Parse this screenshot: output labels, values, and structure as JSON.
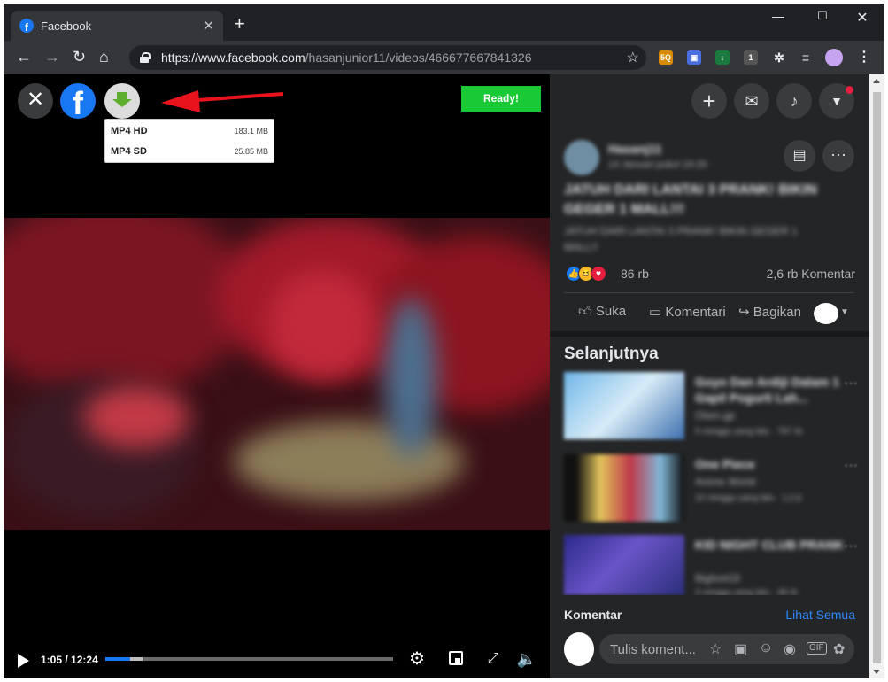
{
  "browser": {
    "tab_title": "Facebook",
    "url_host": "https://www.facebook.com",
    "url_path": "/hasanjunior11/videos/466677667841326",
    "new_tab_label": "+",
    "extension_badge": "1"
  },
  "downloader": {
    "ready_label": "Ready!",
    "options": [
      {
        "format": "MP4 HD",
        "size": "183.1 MB"
      },
      {
        "format": "MP4 SD",
        "size": "25.85 MB"
      }
    ]
  },
  "player": {
    "time_current": "1:05",
    "time_separator": " / ",
    "time_total": "12:24",
    "progress_played": 0.087,
    "progress_buffered": 0.13
  },
  "post": {
    "author": "Hasanj11",
    "date": "14 Januari pukul 19:26 · ",
    "title": "JATUH DARI LANTAI 3 PRANK! BIKIN GEGER 1 MALL!!!",
    "description": "JATUH DARI LANTAI 3 PRANK! BIKIN GEGER 1 MALL!!",
    "reactions_count": "86 rb",
    "comments_count": "2,6 rb Komentar",
    "like_label": "Suka",
    "comment_label": "Komentari",
    "share_label": "Bagikan"
  },
  "next": {
    "heading": "Selanjutnya",
    "items": [
      {
        "title": "Goyo Dan Ardiji Dalam 1 Gapil Pogurli Lah...",
        "channel": "Olam.gp",
        "meta": "5 minggu yang lalu · 797 rb"
      },
      {
        "title": "One Piece",
        "channel": "Anime World",
        "meta": "10 minggu yang lalu · 1,2 jt"
      },
      {
        "title": "KID NIGHT CLUB PRANK",
        "channel": "Bigfoot19",
        "meta": "3 minggu yang lalu · 48 rb"
      }
    ]
  },
  "comments": {
    "heading": "Komentar",
    "see_all": "Lihat Semua",
    "placeholder": "Tulis koment..."
  },
  "colors": {
    "facebook_blue": "#1877f2",
    "ready_green": "#19c935",
    "panel_bg": "#242526"
  }
}
